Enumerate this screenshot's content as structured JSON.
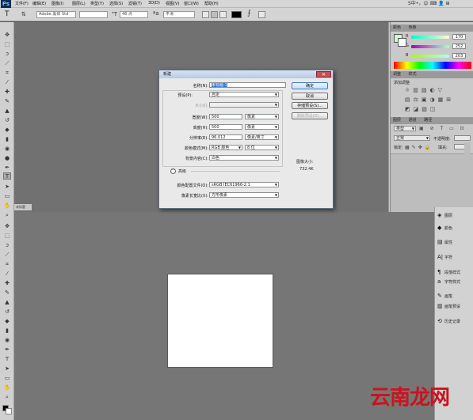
{
  "menubar": {
    "logo": "Ps",
    "items": [
      "文件(F)",
      "编辑(E)",
      "图像(I)",
      "图层(L)",
      "类型(Y)",
      "选择(S)",
      "滤镜(T)",
      "3D(D)",
      "视图(V)",
      "窗口(W)",
      "帮助(H)"
    ],
    "ime_text": "S中•，☺ ⌨ 👤 ⊞"
  },
  "optbar": {
    "font_family": "Adobe 黑体 Std",
    "font_style": "",
    "font_size": "48 点",
    "antialias": "平滑",
    "text_color": "#000000"
  },
  "right_panel": {
    "color_tabs": [
      "颜色",
      "色板"
    ],
    "r_value": "170",
    "g_value": "252",
    "b_value": "203",
    "foreground_color": "#ccffcc",
    "adjust_tabs": [
      "调整",
      "样式"
    ],
    "adjust_label": "添加调整",
    "layer_tabs": [
      "图层",
      "通道",
      "路径"
    ],
    "layer_kind": "类型",
    "blend_mode": "正常",
    "opacity_label": "不透明度:",
    "lock_label": "锁定:",
    "fill_label": "填充:"
  },
  "dock": {
    "items": [
      "图层",
      "颜色",
      "属性",
      "字符",
      "段落样式",
      "字符样式",
      "画笔",
      "画笔预设",
      "历史记录"
    ]
  },
  "tab_label": "未标题",
  "dialog": {
    "title": "新建",
    "name_label": "名称(N):",
    "name_value": "未标题-1",
    "preset_label": "预设(P):",
    "preset_value": "自定",
    "size_label": "大小(I):",
    "width_label": "宽度(W):",
    "width_value": "500",
    "width_unit": "像素",
    "height_label": "高度(H):",
    "height_value": "500",
    "height_unit": "像素",
    "resolution_label": "分辨率(R):",
    "resolution_value": "96.012",
    "resolution_unit": "像素/英寸",
    "color_mode_label": "颜色模式(M):",
    "color_mode_value": "RGB 颜色",
    "bit_depth": "8 位",
    "bg_label": "背景内容(C):",
    "bg_value": "白色",
    "advanced_label": "高级",
    "profile_label": "颜色配置文件(O):",
    "profile_value": "sRGB IEC61966-2.1",
    "pixel_aspect_label": "像素长宽比(X):",
    "pixel_aspect_value": "方形像素",
    "ok_label": "确定",
    "cancel_label": "取消",
    "save_preset_label": "存储预设(S)...",
    "delete_preset_label": "删除预设(D)...",
    "image_size_label": "图像大小:",
    "image_size_value": "732.4K"
  },
  "watermark": "云南龙网"
}
